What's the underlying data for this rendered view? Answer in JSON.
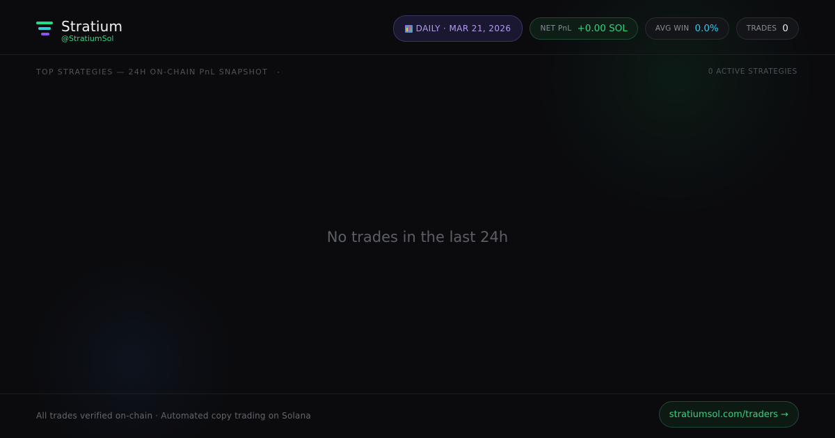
{
  "brand": {
    "name": "Stratium",
    "handle": "@StratiumSol",
    "colors": {
      "accent_green": "#22dd88",
      "accent_cyan": "#33ccdd",
      "accent_purple": "#8855ee"
    }
  },
  "header": {
    "date_pill": {
      "icon": "bar-chart-icon",
      "text": "DAILY · MAR 21, 2026"
    },
    "stats": {
      "net_pnl": {
        "label": "NET PnL",
        "value": "+0.00 SOL"
      },
      "avg_win": {
        "label": "AVG WIN",
        "value": "0.0%"
      },
      "trades": {
        "label": "TRADES",
        "value": "0"
      }
    }
  },
  "section": {
    "title": "TOP STRATEGIES — 24H ON-CHAIN PnL SNAPSHOT",
    "active_count": "0 ACTIVE STRATEGIES"
  },
  "empty_state": {
    "message": "No trades in the last 24h"
  },
  "footer": {
    "note": "All trades verified on-chain · Automated copy trading on Solana",
    "link_label": "stratiumsol.com/traders →"
  }
}
